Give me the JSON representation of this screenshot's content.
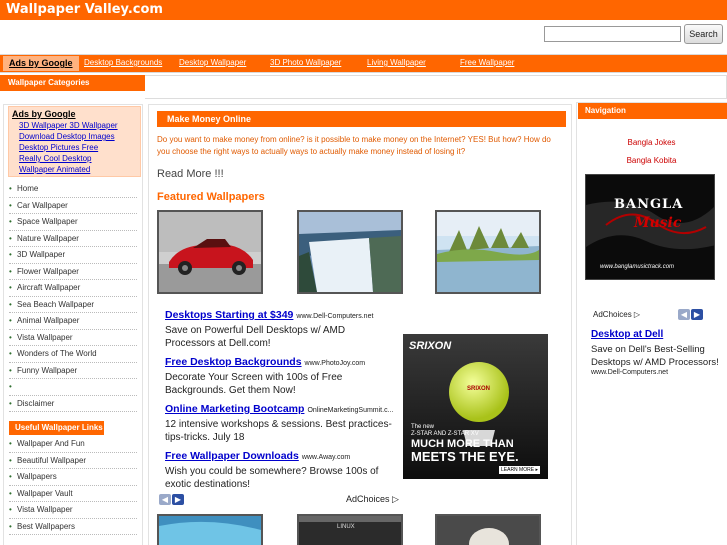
{
  "site": {
    "title": "Wallpaper Valley.com"
  },
  "search": {
    "value": "",
    "button_label": "Search"
  },
  "nav": {
    "ads_label": "Ads by Google",
    "links": [
      "Desktop Backgrounds",
      "Desktop Wallpaper",
      "3D Photo Wallpaper",
      "Living Wallpaper",
      "Free Wallpaper"
    ]
  },
  "sidebar": {
    "categories_title": "Wallpaper Categories",
    "ads_title": "Ads by Google",
    "ad_links": [
      "3D Wallpaper 3D Wallpaper",
      "Download Desktop Images",
      "Desktop Pictures Free",
      "Really Cool Desktop",
      "Wallpaper Animated"
    ],
    "items": [
      "Home",
      "Car Wallpaper",
      "Space Wallpaper",
      "Nature Wallpaper",
      "3D Wallpaper",
      "Flower Wallpaper",
      "Aircraft Wallpaper",
      "Sea Beach Wallpaper",
      "Animal Wallpaper",
      "Vista Wallpaper",
      "Wonders of The World",
      "Funny Wallpaper",
      "",
      "Disclaimer"
    ],
    "useful_title": "Useful Wallpaper Links",
    "useful_items": [
      "Wallpaper And Fun",
      "Beautiful Wallpaper",
      "Wallpapers",
      "Wallpaper Vault",
      "Vista Wallpaper",
      "Best Wallpapers"
    ],
    "bullet": "•"
  },
  "main": {
    "header": "Make Money Online",
    "intro": "Do you want to make money from online? is it possible to make money on the Internet? YES! But how? How do you choose the right ways to actually ways to actually make money instead of losing it?",
    "read_more": "Read More !!!",
    "featured_title": "Featured Wallpapers",
    "ads": [
      {
        "title": "Desktops Starting at $349",
        "url": "www.Dell-Computers.net",
        "desc": "Save on Powerful Dell Desktops w/ AMD Processors at Dell.com!"
      },
      {
        "title": "Free Desktop Backgrounds",
        "url": "www.PhotoJoy.com",
        "desc": "Decorate Your Screen with 100s of Free Backgrounds. Get them Now!"
      },
      {
        "title": "Online Marketing Bootcamp",
        "url": "OnlineMarketingSummit.c...",
        "desc": "12 intensive workshops & sessions. Best practices-tips-tricks. July 18"
      },
      {
        "title": "Free Wallpaper Downloads",
        "url": "www.Away.com",
        "desc": "Wish you could be somewhere? Browse 100s of exotic destinations!"
      }
    ],
    "adchoices": "AdChoices",
    "arrow_left": "◀",
    "arrow_right": "▶",
    "srixon": {
      "brand": "SRIXON",
      "ball_text": "SRIXON",
      "line1": "The new",
      "line2": "Z-STAR AND Z-STAR XV",
      "line3": "MUCH MORE THAN",
      "line4": "MEETS THE EYE.",
      "learn_more": "LEARN MORE ▸"
    },
    "thumb_label": "LINUX"
  },
  "right": {
    "nav_title": "Navigation",
    "links": [
      "Bangla Jokes",
      "Bangla Kobita"
    ],
    "banner": {
      "title": "BANGLA",
      "subtitle": "Music",
      "url": "www.banglamusictrack.com"
    },
    "adchoices": "AdChoices",
    "ad": {
      "title": "Desktop at Dell",
      "desc": "Save on Dell's Best-Selling Desktops w/ AMD Processors!",
      "url": "www.Dell-Computers.net"
    }
  },
  "colors": {
    "accent": "#ff6600",
    "link": "#0000cc",
    "nav_link": "#cc0000"
  }
}
